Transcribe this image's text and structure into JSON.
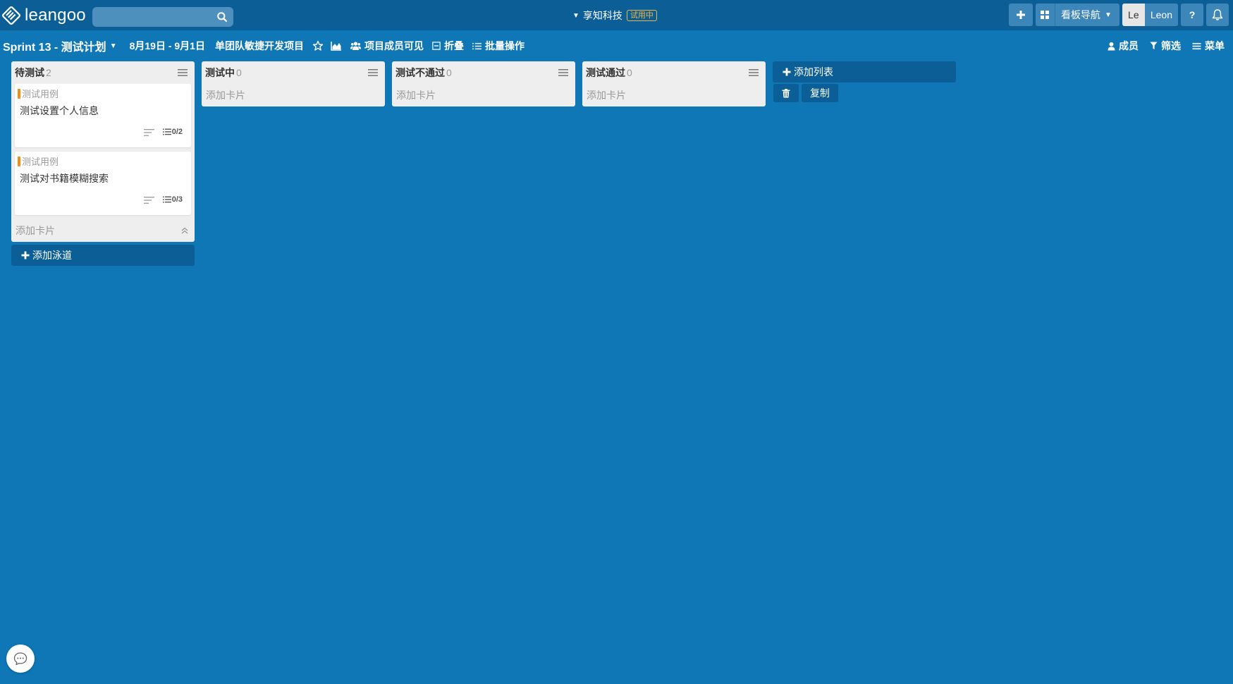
{
  "app": {
    "logo_text": "leangoo"
  },
  "search": {
    "placeholder": "",
    "value": ""
  },
  "org": {
    "name": "享知科技",
    "badge": "试用中"
  },
  "topbar": {
    "nav_label": "看板导航",
    "avatar_initials": "Le",
    "user_name": "Leon",
    "help_label": "?"
  },
  "board": {
    "title": "Sprint 13 - 测试计划",
    "date_range": "8月19日 - 9月1日",
    "project": "单团队敏捷开发项目",
    "visibility": "项目成员可见",
    "collapse": "折叠",
    "batch": "批量操作",
    "members": "成员",
    "filter": "筛选",
    "menu": "菜单"
  },
  "lists": [
    {
      "title": "待测试",
      "count": "2",
      "add_card": "添加卡片",
      "cards": [
        {
          "tag": "测试用例",
          "title": "测试设置个人信息",
          "checklist": "0/2"
        },
        {
          "tag": "测试用例",
          "title": "测试对书籍模糊搜索",
          "checklist": "0/3"
        }
      ]
    },
    {
      "title": "测试中",
      "count": "0",
      "add_card": "添加卡片",
      "cards": []
    },
    {
      "title": "测试不通过",
      "count": "0",
      "add_card": "添加卡片",
      "cards": []
    },
    {
      "title": "测试通过",
      "count": "0",
      "add_card": "添加卡片",
      "cards": []
    }
  ],
  "actions": {
    "add_lane": "添加泳道",
    "add_list": "添加列表",
    "copy": "复制"
  },
  "colors": {
    "background": "#0f77b6",
    "header": "#0c5f96",
    "list_bg": "#eeeeee",
    "tag_orange": "#f28c18",
    "trial_badge": "#f2b53f"
  },
  "icons": {
    "logo": "leangoo-logo-icon",
    "search": "search-icon",
    "plus": "plus-icon",
    "grid": "grid-icon",
    "bell": "bell-icon",
    "star": "star-icon",
    "chart": "area-chart-icon",
    "users": "users-icon",
    "collapse": "collapse-square-icon",
    "batch": "list-icon",
    "user": "user-icon",
    "filter": "filter-icon",
    "menu": "hamburger-icon",
    "trash": "trash-icon",
    "chat": "chat-icon"
  }
}
